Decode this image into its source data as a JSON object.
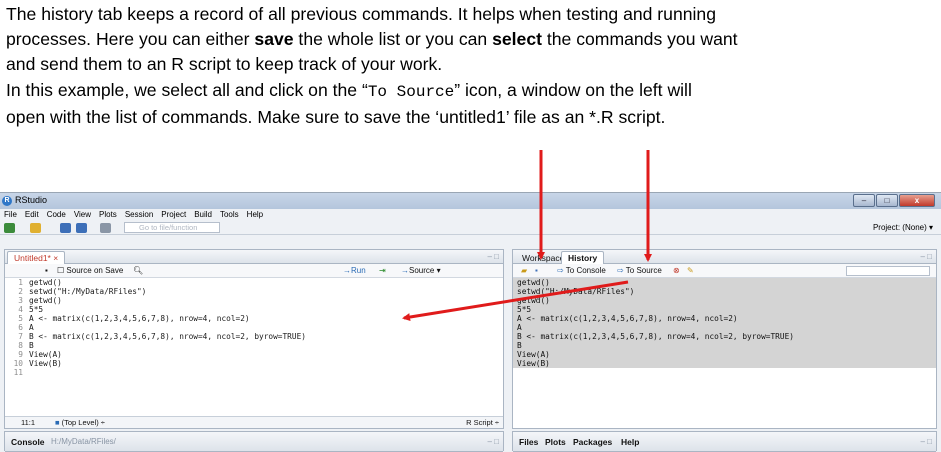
{
  "intro": {
    "l1": "The history tab keeps a record of all previous commands. It helps when testing and running",
    "l2a": "processes. Here you can either ",
    "l2b": "save",
    "l2c": " the whole list or you can ",
    "l2d": "select",
    "l2e": " the commands you want",
    "l3": "and send them to an R script to keep track of your work.",
    "l4": "In this example, we select all and click on the “",
    "l4mono": "To Source",
    "l4b": "” icon, a window on the left will",
    "l5": "open with the list of commands. Make sure to save the ‘untitled1’ file as an *.R script."
  },
  "window": {
    "title": "RStudio",
    "controls": [
      "–",
      "□",
      "x"
    ],
    "menu": [
      "File",
      "Edit",
      "Code",
      "View",
      "Plots",
      "Session",
      "Project",
      "Build",
      "Tools",
      "Help"
    ],
    "goto_placeholder": "Go to file/function",
    "project": "Project: (None) ▾"
  },
  "editor": {
    "tab": "Untitled1* ×",
    "source_on_save": "Source on Save",
    "run": "Run",
    "source": "Source ▾",
    "lines": [
      {
        "n": "1",
        "t": "getwd()"
      },
      {
        "n": "2",
        "t": "setwd(\"H:/MyData/RFiles\")"
      },
      {
        "n": "3",
        "t": "getwd()"
      },
      {
        "n": "4",
        "t": "5*5"
      },
      {
        "n": "5",
        "t": "A <- matrix(c(1,2,3,4,5,6,7,8), nrow=4, ncol=2)"
      },
      {
        "n": "6",
        "t": "A"
      },
      {
        "n": "7",
        "t": "B <- matrix(c(1,2,3,4,5,6,7,8), nrow=4, ncol=2, byrow=TRUE)"
      },
      {
        "n": "8",
        "t": "B"
      },
      {
        "n": "9",
        "t": "View(A)"
      },
      {
        "n": "10",
        "t": "View(B)"
      },
      {
        "n": "11",
        "t": ""
      }
    ],
    "status_pos": "11:1",
    "status_level": "(Top Level) ÷",
    "status_type": "R Script ÷"
  },
  "history": {
    "tab_workspace": "Workspace",
    "tab_history": "History",
    "to_console": "To Console",
    "to_source": "To Source",
    "lines": [
      "getwd()",
      "setwd(\"H:/MyData/RFiles\")",
      "getwd()",
      "5*5",
      "A <- matrix(c(1,2,3,4,5,6,7,8), nrow=4, ncol=2)",
      "A",
      "B <- matrix(c(1,2,3,4,5,6,7,8), nrow=4, ncol=2, byrow=TRUE)",
      "B",
      "View(A)",
      "View(B)"
    ]
  },
  "console": {
    "label": "Console",
    "path": "H:/MyData/RFiles/"
  },
  "files_pane": {
    "tabs": [
      "Files",
      "Plots",
      "Packages",
      "Help"
    ]
  },
  "colors": {
    "arrow": "#e01b1b",
    "history_bg": "#d4d4d4"
  }
}
